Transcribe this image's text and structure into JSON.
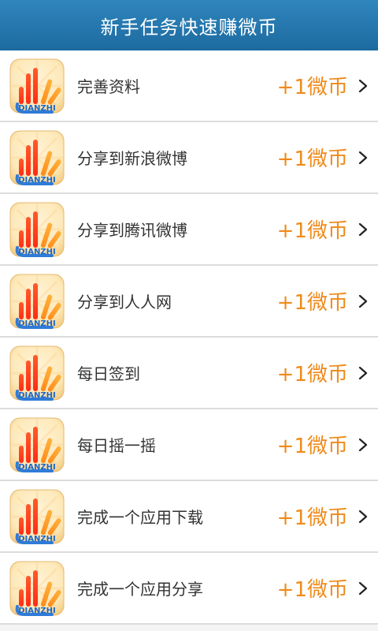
{
  "header": {
    "title": "新手任务快速赚微币"
  },
  "app_icon": {
    "brand_text": "DIANZHI"
  },
  "tasks": [
    {
      "label": "完善资料",
      "reward": "+1微币"
    },
    {
      "label": "分享到新浪微博",
      "reward": "+1微币"
    },
    {
      "label": "分享到腾讯微博",
      "reward": "+1微币"
    },
    {
      "label": "分享到人人网",
      "reward": "+1微币"
    },
    {
      "label": "每日签到",
      "reward": "+1微币"
    },
    {
      "label": "每日摇一摇",
      "reward": "+1微币"
    },
    {
      "label": "完成一个应用下载",
      "reward": "+1微币"
    },
    {
      "label": "完成一个应用分享",
      "reward": "+1微币"
    }
  ],
  "chevron": ">",
  "colors": {
    "header_bg": "#2478b0",
    "reward": "#ef8a1a",
    "label": "#333333"
  }
}
